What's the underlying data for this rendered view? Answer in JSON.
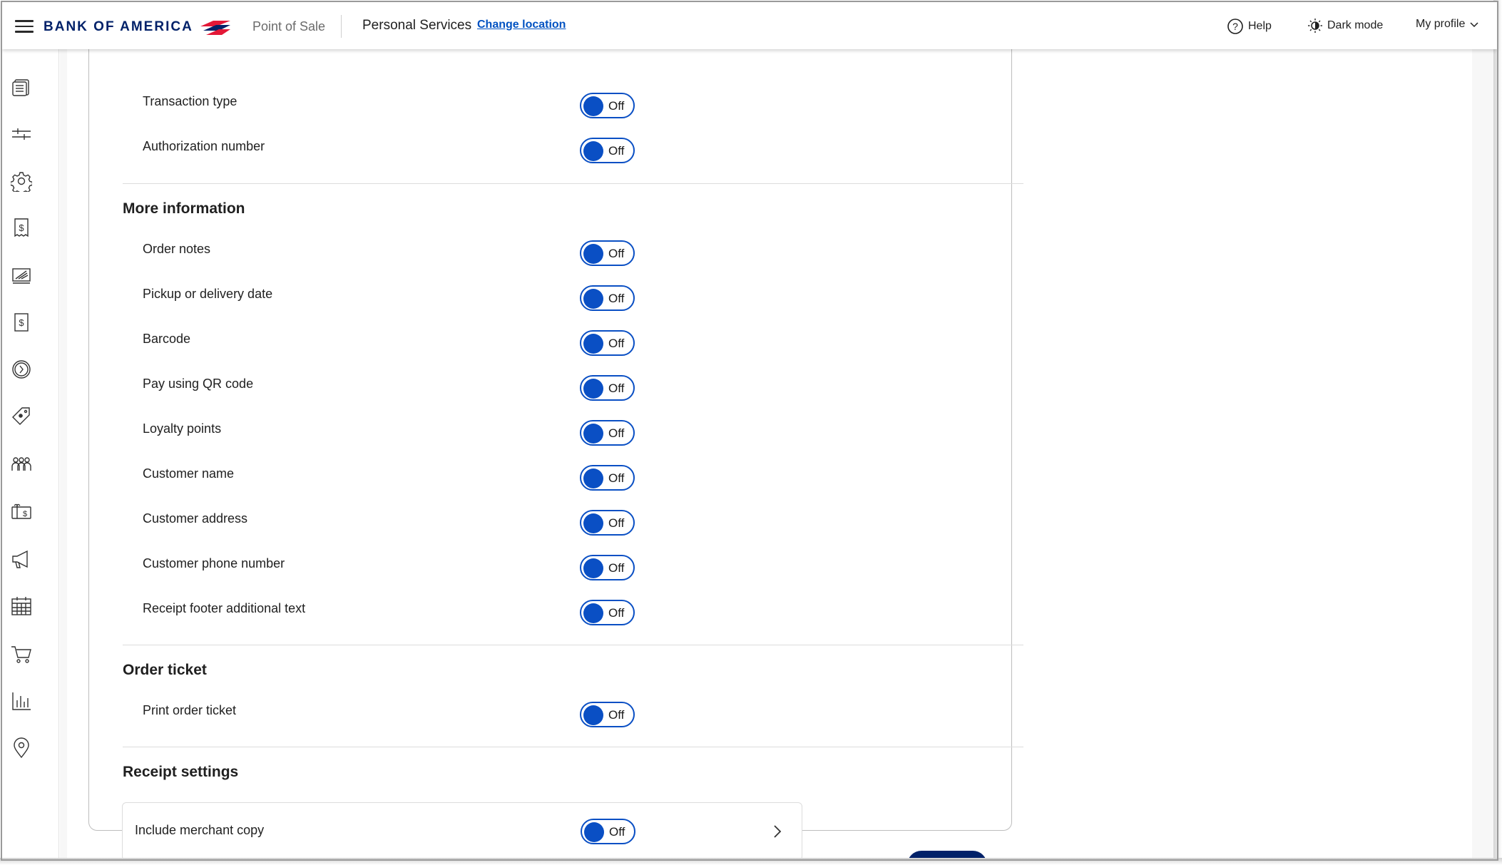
{
  "header": {
    "logo_text": "BANK OF AMERICA",
    "app_name": "Point of Sale",
    "location": "Personal Services",
    "change_location": "Change location",
    "help": "Help",
    "dark_mode": "Dark mode",
    "profile": "My profile"
  },
  "sidebar": {
    "items": [
      "transactions-icon",
      "sliders-icon",
      "gear-icon",
      "invoice-dollar-icon",
      "chart-screen-icon",
      "receipt-dollar-icon",
      "clock-icon",
      "tag-icon",
      "customers-icon",
      "gift-card-icon",
      "megaphone-icon",
      "calendar-icon",
      "cart-icon",
      "bar-chart-icon",
      "location-pin-icon"
    ]
  },
  "toggle_off_label": "Off",
  "rows_top": [
    {
      "label": "Transaction type",
      "state": "Off"
    },
    {
      "label": "Authorization number",
      "state": "Off"
    }
  ],
  "more_information": {
    "title": "More information",
    "rows": [
      {
        "label": "Order notes",
        "state": "Off"
      },
      {
        "label": "Pickup or delivery date",
        "state": "Off"
      },
      {
        "label": "Barcode",
        "state": "Off"
      },
      {
        "label": "Pay using QR code",
        "state": "Off"
      },
      {
        "label": "Loyalty points",
        "state": "Off"
      },
      {
        "label": "Customer name",
        "state": "Off"
      },
      {
        "label": "Customer address",
        "state": "Off"
      },
      {
        "label": "Customer phone number",
        "state": "Off"
      },
      {
        "label": "Receipt footer additional text",
        "state": "Off"
      }
    ]
  },
  "order_ticket": {
    "title": "Order ticket",
    "rows": [
      {
        "label": "Print order ticket",
        "state": "Off"
      }
    ]
  },
  "receipt_settings": {
    "title": "Receipt settings",
    "merchant_copy_label": "Include merchant copy",
    "merchant_copy_state": "Off"
  },
  "colors": {
    "brand_navy": "#012169",
    "brand_red": "#e31837",
    "toggle_blue": "#0a4fc4",
    "link_blue": "#0052c2"
  }
}
